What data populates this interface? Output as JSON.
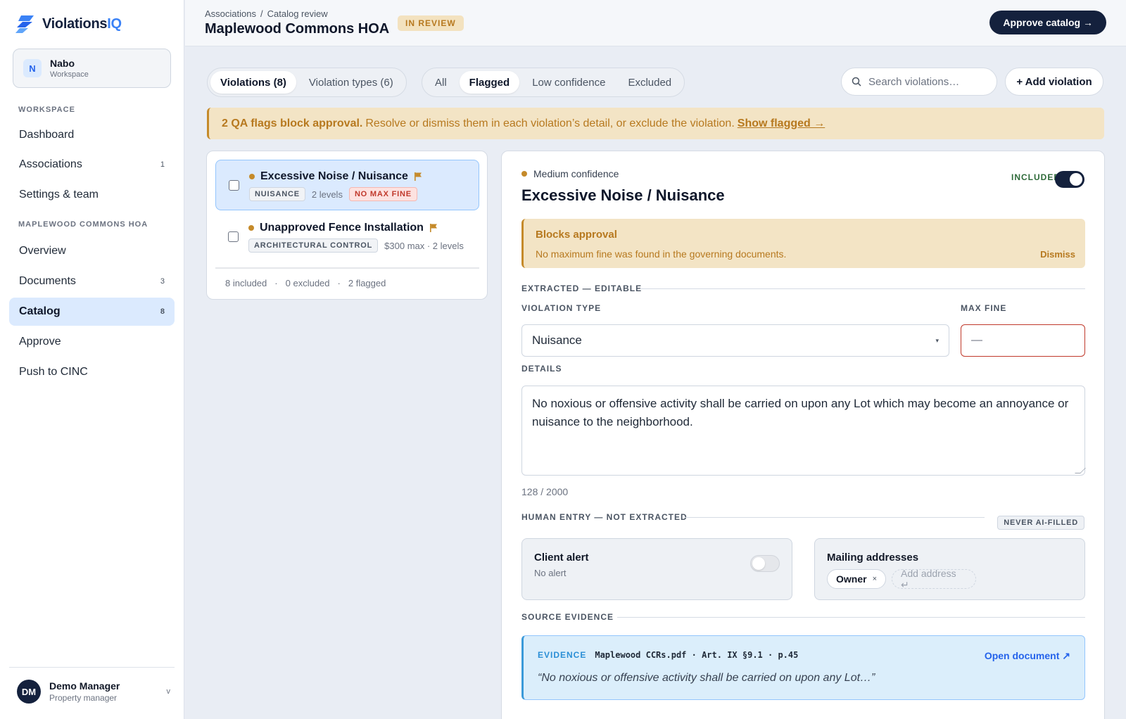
{
  "app": {
    "logo_main": "Violations",
    "logo_accent": "IQ"
  },
  "workspace": {
    "initial": "N",
    "name": "Nabo",
    "sub": "Workspace"
  },
  "sidebar": {
    "section1": "WORKSPACE",
    "items1": [
      {
        "label": "Dashboard",
        "count": ""
      },
      {
        "label": "Associations",
        "count": "1"
      },
      {
        "label": "Settings & team",
        "count": ""
      }
    ],
    "section2": "MAPLEWOOD COMMONS HOA",
    "items2": [
      {
        "label": "Overview",
        "count": ""
      },
      {
        "label": "Documents",
        "count": "3"
      },
      {
        "label": "Catalog",
        "count": "8",
        "active": true
      },
      {
        "label": "Approve",
        "count": ""
      },
      {
        "label": "Push to CINC",
        "count": ""
      }
    ]
  },
  "user": {
    "initials": "DM",
    "name": "Demo Manager",
    "role": "Property manager",
    "chevron": "v"
  },
  "header": {
    "breadcrumb": [
      "Associations",
      "Catalog review"
    ],
    "breadcrumb_sep": "/",
    "title": "Maplewood Commons HOA",
    "status": "IN REVIEW",
    "approve_label": "Approve catalog →"
  },
  "toolbar": {
    "views": [
      "Violations (8)",
      "Violation types (6)"
    ],
    "filters": [
      "All",
      "Flagged",
      "Low confidence",
      "Excluded"
    ],
    "search_placeholder": "Search violations…",
    "add_label": "+ Add violation"
  },
  "banner": {
    "bold": "2 QA flags block approval.",
    "text": "Resolve or dismiss them in each violation’s detail, or exclude the violation.",
    "link": "Show flagged →"
  },
  "list": {
    "items": [
      {
        "title": "Excessive Noise / Nuisance",
        "tag": "NUISANCE",
        "meta": "2 levels",
        "warn_tag": "NO MAX FINE"
      },
      {
        "title": "Unapproved Fence Installation",
        "tag": "ARCHITECTURAL CONTROL",
        "meta": "$300 max · 2 levels"
      }
    ],
    "summary": [
      "8 included",
      "·",
      "0 excluded",
      "·",
      "2 flagged"
    ]
  },
  "detail": {
    "confidence": "Medium confidence",
    "title": "Excessive Noise / Nuisance",
    "included_label": "INCLUDED",
    "block_title": "Blocks approval",
    "block_text": "No maximum fine was found in the governing documents.",
    "dismiss": "Dismiss",
    "extracted_head": "EXTRACTED — EDITABLE",
    "type_label": "VIOLATION TYPE",
    "type_value": "Nuisance",
    "caret": "▾",
    "maxfine_label": "MAX FINE",
    "maxfine_value": "—",
    "details_label": "DETAILS",
    "details_text": "No noxious or offensive activity shall be carried on upon any Lot which may become an annoyance or nuisance to the neighborhood.",
    "char_count": "128 / 2000",
    "human_head": "HUMAN ENTRY — NOT EXTRACTED",
    "never_badge": "NEVER AI-FILLED",
    "client_alert_title": "Client alert",
    "client_alert_sub": "No alert",
    "mailing_title": "Mailing addresses",
    "chip_owner": "Owner",
    "chip_x": "×",
    "add_address": "Add address ↵",
    "source_head": "SOURCE EVIDENCE",
    "evidence_label": "EVIDENCE",
    "evidence_src": "Maplewood CCRs.pdf · Art. IX §9.1 · p.45",
    "open_doc": "Open document ↗",
    "quote": "“No noxious or offensive activity shall be carried on upon any Lot…”"
  }
}
